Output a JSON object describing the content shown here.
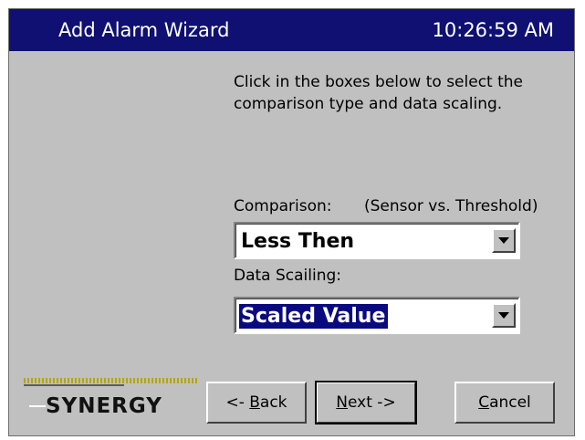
{
  "window": {
    "title": "Add Alarm Wizard",
    "time": "10:26:59 AM"
  },
  "instructions": "Click in the boxes below to select the comparison type and data scaling.",
  "comparison": {
    "label": "Comparison:",
    "hint": "(Sensor vs. Threshold)",
    "selected": "Less Then"
  },
  "scaling": {
    "label": "Data Scailing:",
    "selected": "Scaled Value"
  },
  "logo": {
    "text": "SYNERGY"
  },
  "buttons": {
    "back": {
      "pre": "<- ",
      "accel": "B",
      "post": "ack"
    },
    "next": {
      "pre": "",
      "accel": "N",
      "post": "ext ->"
    },
    "cancel": {
      "pre": "",
      "accel": "C",
      "post": "ancel"
    }
  },
  "colors": {
    "titlebar": "#0f1071",
    "window_bg": "#c0c0c0",
    "selection": "#0a0a80",
    "logo_dots": "#b8a400"
  },
  "icons": {
    "dropdown": "chevron-down-icon"
  }
}
